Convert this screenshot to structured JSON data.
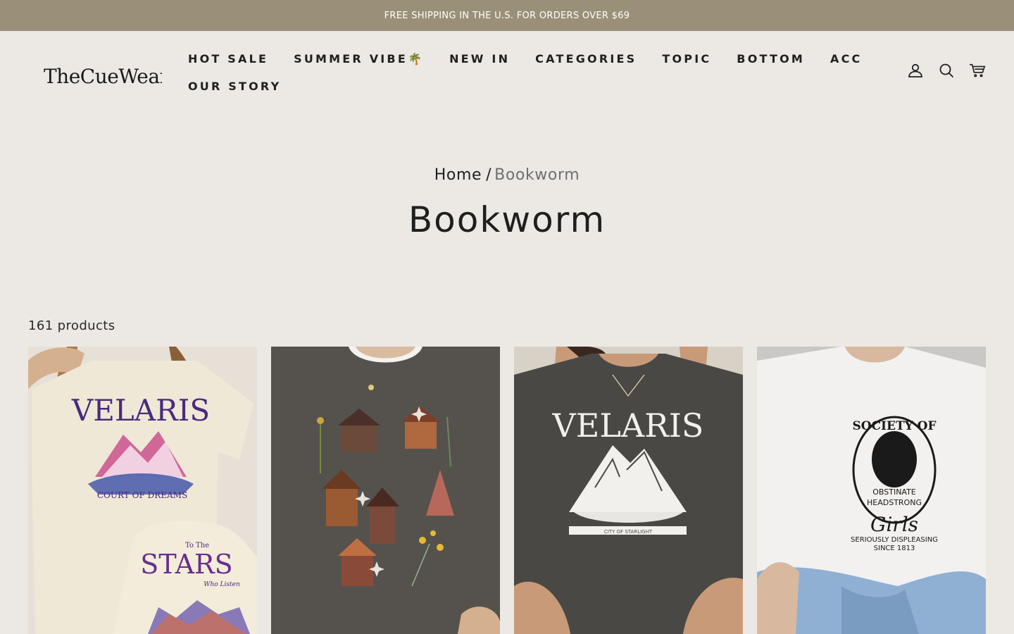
{
  "announcement": "FREE SHIPPING IN THE U.S. FOR ORDERS OVER $69",
  "brand": {
    "name": "TheCueWear",
    "logo_text": "TheCueWear"
  },
  "nav": {
    "row1": [
      "HOT SALE",
      "SUMMER VIBE🌴",
      "NEW IN",
      "CATEGORIES",
      "TOPIC",
      "BOTTOM",
      "ACC"
    ],
    "row2": [
      "OUR STORY"
    ]
  },
  "header_icons": [
    "user-icon",
    "search-icon",
    "cart-icon"
  ],
  "breadcrumb": {
    "home": "Home",
    "separator": "/",
    "current": "Bookworm"
  },
  "page_title": "Bookworm",
  "product_count": "161 products",
  "products": [
    {
      "image_text": [
        "VELARIS",
        "COURT OF DREAMS",
        "To The",
        "STARS",
        "Who Listen"
      ],
      "shirt_color": "#efe8d6",
      "background": "#e6e0d6"
    },
    {
      "image_text": [],
      "shirt_color": "#55524e",
      "background": "#d9d3c9"
    },
    {
      "image_text": [
        "VELARIS",
        "CITY OF STARLIGHT"
      ],
      "shirt_color": "#4a4845",
      "background": "#d8d1c6"
    },
    {
      "image_text": [
        "SOCIETY OF",
        "OBSTINATE",
        "HEADSTRONG",
        "Girls",
        "SERIOUSLY DISPLEASING",
        "SINCE 1813"
      ],
      "shirt_color": "#f2f1ef",
      "background": "#c9c8c6"
    }
  ]
}
